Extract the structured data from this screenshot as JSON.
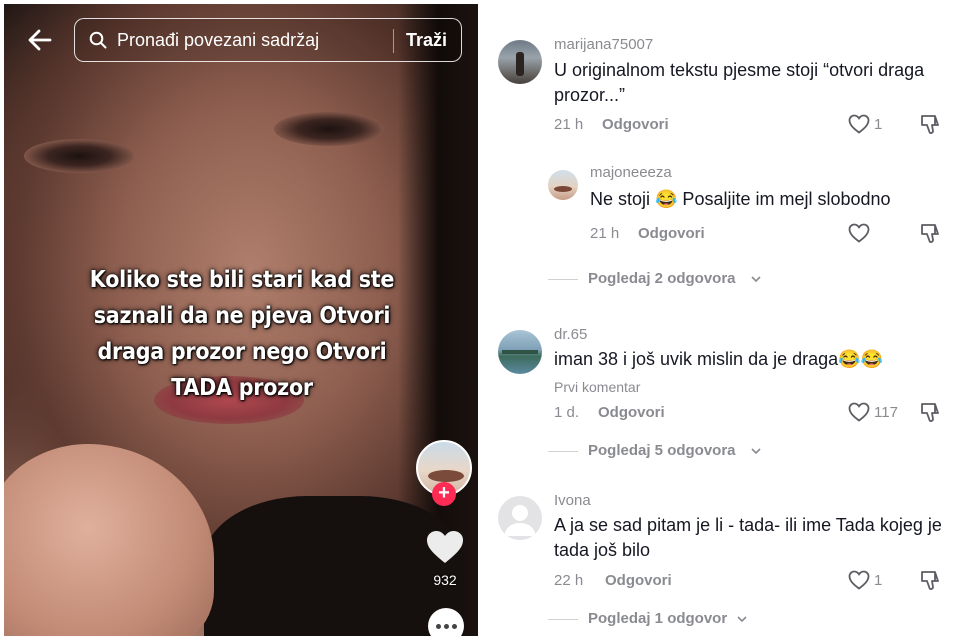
{
  "video": {
    "search_placeholder": "Pronađi povezani sadržaj",
    "search_button": "Traži",
    "caption": "Koliko ste bili stari kad ste saznali da ne pjeva Otvori draga prozor nego Otvori TADA prozor",
    "like_count": "932"
  },
  "comments": [
    {
      "user": "marijana75007",
      "text": "U originalnom tekstu pjesme stoji “otvori draga prozor...”",
      "time": "21 h",
      "reply_label": "Odgovori",
      "likes": "1"
    },
    {
      "user": "majoneeeza",
      "text": "Ne stoji 😂 Posaljite im mejl slobodno",
      "time": "21 h",
      "reply_label": "Odgovori",
      "likes": ""
    },
    {
      "user": "dr.65",
      "text": "iman 38 i još uvik mislin da je draga😂😂",
      "time": "1 d.",
      "reply_label": "Odgovori",
      "likes": "117",
      "tag": "Prvi komentar"
    },
    {
      "user": "Ivona",
      "text": "A ja se sad pitam je li - tada- ili ime Tada kojeg je tada još bilo",
      "time": "22 h",
      "reply_label": "Odgovori",
      "likes": "1"
    }
  ],
  "view_replies": [
    "Pogledaj 2 odgovora",
    "Pogledaj 5 odgovora",
    "Pogledaj 1 odgovor"
  ],
  "colors": {
    "accent_red": "#fe2c55",
    "text_primary": "#161823",
    "text_secondary": "#8a8b91"
  }
}
